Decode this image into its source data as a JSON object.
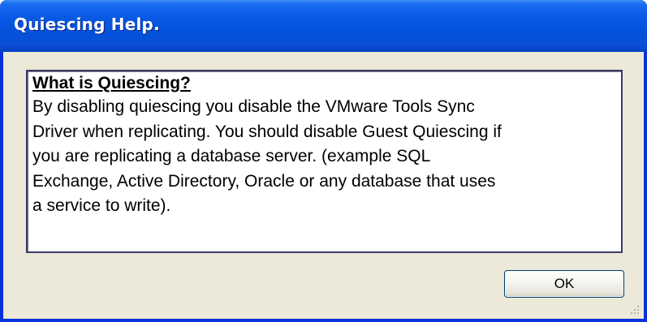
{
  "window": {
    "title": "Quiescing Help."
  },
  "help": {
    "heading": "What is Quiescing?",
    "lines": [
      "By disabling quiescing you disable the VMware Tools Sync",
      "Driver when replicating. You should disable Guest Quiescing if",
      "you are replicating a database server. (example SQL",
      "Exchange, Active Directory, Oracle or any database that uses",
      "a service to write)."
    ]
  },
  "buttons": {
    "ok_label": "OK"
  },
  "icons": {
    "resize_grip": "resize-grip-icon"
  },
  "colors": {
    "titlebar": "#0a5ae6",
    "client": "#ece9d8",
    "frame": "#0831d9"
  }
}
